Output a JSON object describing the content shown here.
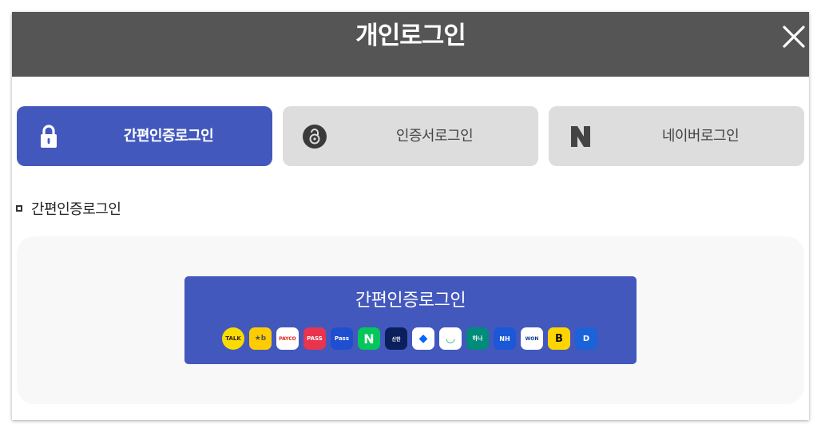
{
  "modal": {
    "title": "개인로그인",
    "close_icon": "close-icon"
  },
  "tabs": [
    {
      "label": "간편인증로그인",
      "icon": "lock-icon",
      "active": true
    },
    {
      "label": "인증서로그인",
      "icon": "certificate-icon",
      "active": false
    },
    {
      "label": "네이버로그인",
      "icon": "naver-icon",
      "active": false
    }
  ],
  "section": {
    "title": "간편인증로그인"
  },
  "login_button": {
    "label": "간편인증로그인"
  },
  "providers": [
    {
      "name": "kakaotalk-icon",
      "text": "TALK"
    },
    {
      "name": "kb-star-icon",
      "text": "★b"
    },
    {
      "name": "payco-icon",
      "text": "PAYCO"
    },
    {
      "name": "pass-icon",
      "text": "PASS"
    },
    {
      "name": "samsung-pass-icon",
      "text": "Pass"
    },
    {
      "name": "naver-app-icon",
      "text": "N"
    },
    {
      "name": "shinhan-icon",
      "text": "신한"
    },
    {
      "name": "toss-icon",
      "text": "◆"
    },
    {
      "name": "bank-sal-icon",
      "text": "◡"
    },
    {
      "name": "hana-icon",
      "text": "하나"
    },
    {
      "name": "nh-icon",
      "text": "NH"
    },
    {
      "name": "woori-won-icon",
      "text": "WON"
    },
    {
      "name": "banksalad-b-icon",
      "text": "B"
    },
    {
      "name": "shield-d-icon",
      "text": "D"
    }
  ],
  "colors": {
    "header_bg": "#555555",
    "accent": "#4358bd",
    "tab_inactive": "#dddddd",
    "panel_bg": "#f8f8f8"
  }
}
